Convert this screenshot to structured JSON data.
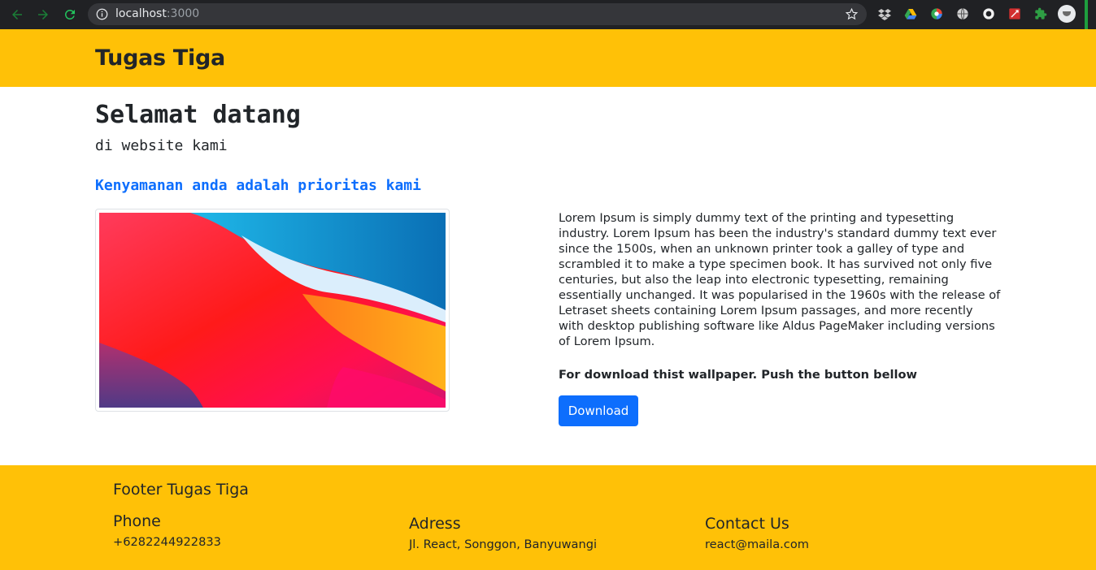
{
  "browser": {
    "url_host": "localhost",
    "url_port": ":3000",
    "extensions": [
      "dropbox-icon",
      "google-drive-icon",
      "colorful-extension-icon",
      "globe-icon",
      "circle-extension-icon",
      "red-extension-icon",
      "puzzle-icon"
    ]
  },
  "navbar": {
    "brand": "Tugas Tiga"
  },
  "main": {
    "welcome_title": "Selamat datang",
    "welcome_subtitle": "di website kami",
    "priority_heading": "Kenyamanan anda adalah prioritas kami",
    "description": "Lorem Ipsum is simply dummy text of the printing and typesetting industry. Lorem Ipsum has been the industry's standard dummy text ever since the 1500s, when an unknown printer took a galley of type and scrambled it to make a type specimen book. It has survived not only five centuries, but also the leap into electronic typesetting, remaining essentially unchanged. It was popularised in the 1960s with the release of Letraset sheets containing Lorem Ipsum passages, and more recently with desktop publishing software like Aldus PageMaker including versions of Lorem Ipsum.",
    "download_note": "For download thist wallpaper. Push the button bellow",
    "download_button": "Download"
  },
  "footer": {
    "title": "Footer Tugas Tiga",
    "phone_label": "Phone",
    "phone_value": "+6282244922833",
    "address_label": "Adress",
    "address_value": "Jl. React, Songgon, Banyuwangi",
    "contact_label": "Contact Us",
    "contact_value": "react@maila.com"
  },
  "colors": {
    "navbar_bg": "#ffc107",
    "footer_bg": "#ffc107",
    "link_blue": "#0d6efd",
    "button_bg": "#0d6efd",
    "chrome_bg": "#202124"
  }
}
